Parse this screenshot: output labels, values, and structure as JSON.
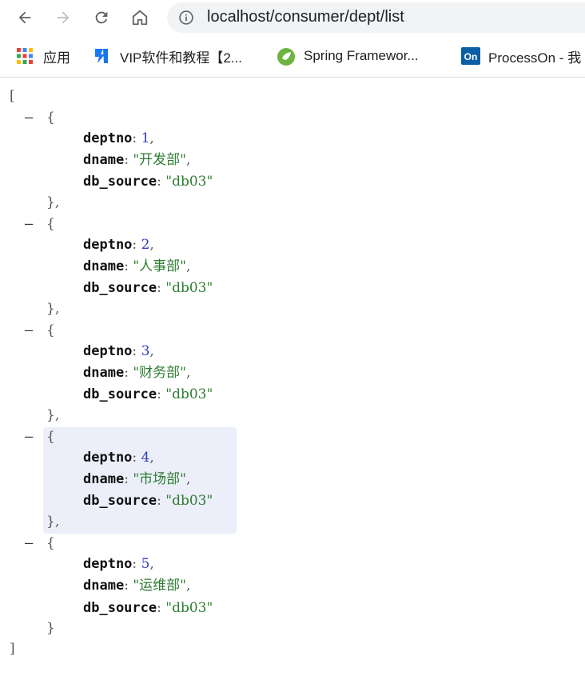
{
  "browser": {
    "url": "localhost/consumer/dept/list"
  },
  "bookmarks": [
    {
      "label": "应用",
      "icon": "apps-grid-icon"
    },
    {
      "label": "VIP软件和教程【2...",
      "icon": "blue-flag-icon"
    },
    {
      "label": "Spring Framewor...",
      "icon": "spring-leaf-icon"
    },
    {
      "label": "ProcessOn - 我",
      "icon": "processon-icon"
    }
  ],
  "json_view": {
    "open_bracket": "[",
    "close_bracket": "]",
    "collapse_glyph": "–",
    "keys": {
      "deptno": "deptno",
      "dname": "dname",
      "db_source": "db_source"
    },
    "items": [
      {
        "deptno": "1",
        "dname": "\"开发部\"",
        "db_source": "\"db03\""
      },
      {
        "deptno": "2",
        "dname": "\"人事部\"",
        "db_source": "\"db03\""
      },
      {
        "deptno": "3",
        "dname": "\"财务部\"",
        "db_source": "\"db03\""
      },
      {
        "deptno": "4",
        "dname": "\"市场部\"",
        "db_source": "\"db03\""
      },
      {
        "deptno": "5",
        "dname": "\"运维部\"",
        "db_source": "\"db03\""
      }
    ]
  },
  "colors": {
    "number": "#2f3fc0",
    "string": "#2e7d32",
    "highlight": "#eceef9"
  }
}
